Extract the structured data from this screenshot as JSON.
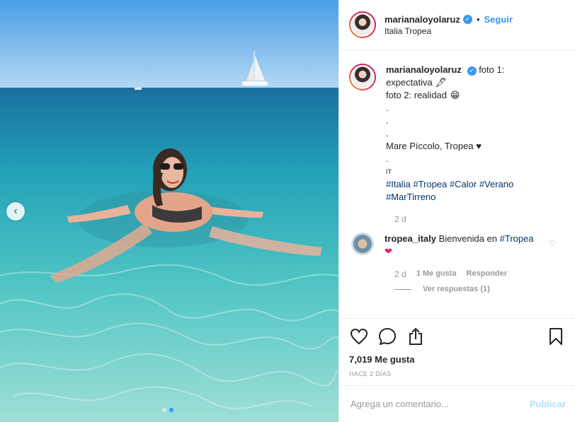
{
  "post": {
    "username": "marianaloyolaruz",
    "follow_label": "Seguir",
    "separator": "•",
    "location": "Italia Tropea",
    "caption": {
      "line1": "foto 1:",
      "line2": "expectativa",
      "line3": "foto 2: realidad",
      "dot1": ".",
      "dot2": ".",
      "dot3": ".",
      "line4": "Mare Píccolo, Tropea",
      "heart": "♥",
      "dot4": ".",
      "flag": "IT",
      "hashtags": [
        "#Italia",
        "#Tropea",
        "#Calor",
        "#Verano",
        "#MarTirreno"
      ],
      "time": "2 d",
      "emoji_pen": "🖋",
      "emoji_grin": "😁"
    },
    "comment": {
      "username": "tropea_italy",
      "text": "Bienvenida en",
      "tag": "#Tropea",
      "emoji": "❤",
      "time": "2 d",
      "likes": "1 Me gusta",
      "reply": "Responder",
      "view_replies": "Ver respuestas (1)"
    },
    "likes": "7,019 Me gusta",
    "ago": "HACE 2 DÍAS",
    "add_comment_placeholder": "Agrega un comentario...",
    "publish_label": "Publicar"
  },
  "icons": {
    "prev": "chevron-left-icon",
    "like": "heart-icon",
    "comment": "comment-icon",
    "share": "share-icon",
    "save": "bookmark-icon",
    "verified": "verified-badge-icon"
  },
  "carousel": {
    "slides": 2,
    "active": 2
  },
  "colors": {
    "accent": "#3897f0",
    "hashtag": "#003569",
    "muted": "#999999",
    "publish_disabled": "#b2dffc"
  }
}
